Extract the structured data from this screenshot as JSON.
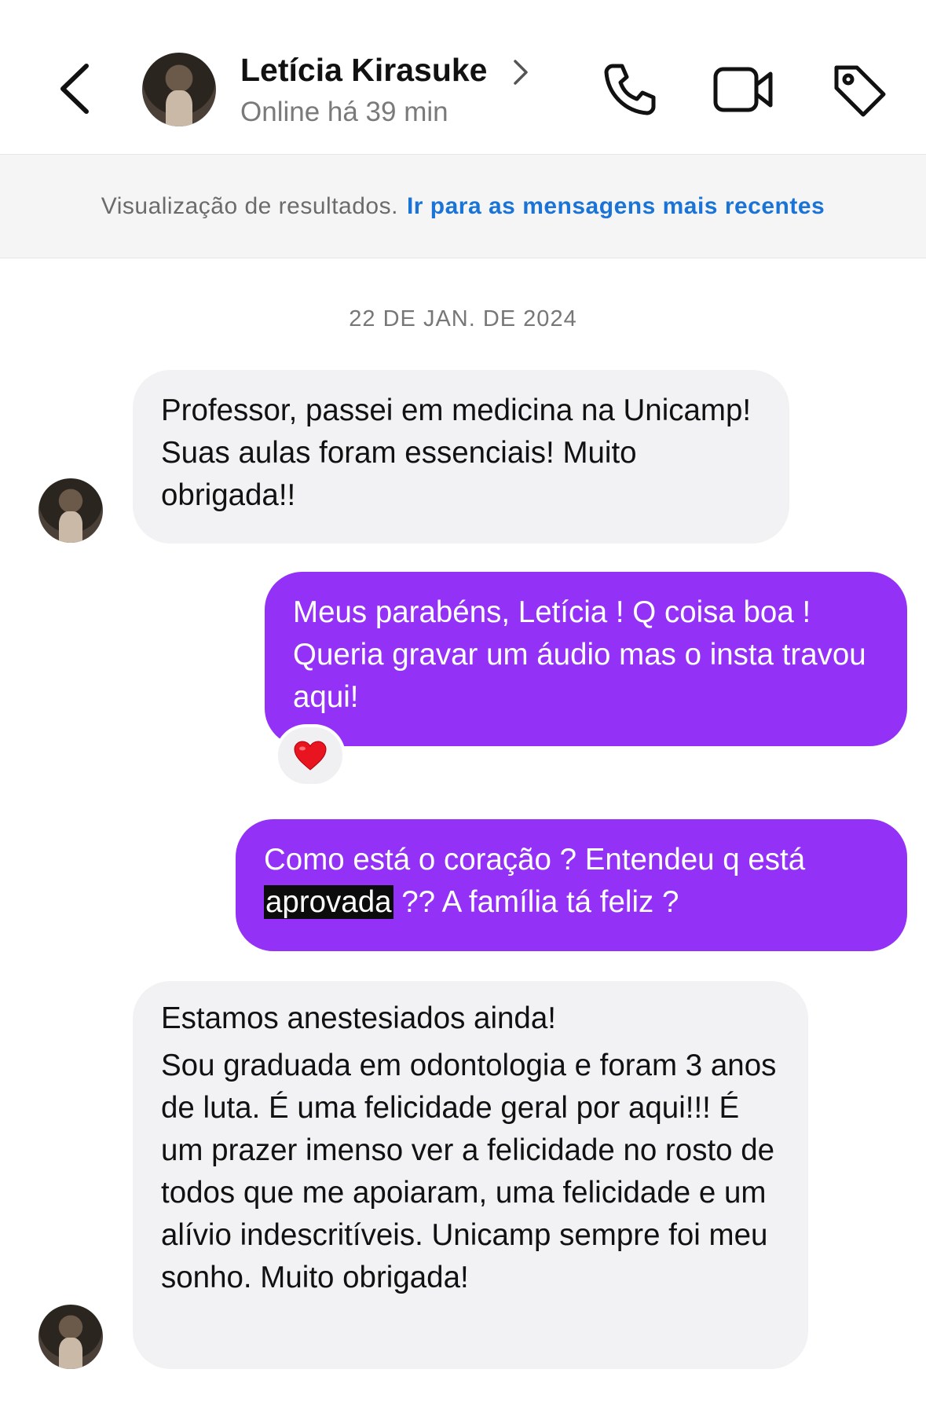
{
  "header": {
    "contact_name": "Letícia Kirasuke",
    "status": "Online há 39 min",
    "icons": [
      "back-icon",
      "chevron-right-icon",
      "phone-icon",
      "video-icon",
      "tag-icon"
    ]
  },
  "banner": {
    "text": "Visualização de resultados.",
    "link": "Ir para as mensagens mais recentes",
    "link_color": "#1a74d8"
  },
  "date_separator": "22 DE JAN. DE 2024",
  "colors": {
    "outgoing_bubble": "#9431f7",
    "incoming_bubble": "#f2f2f4",
    "highlight": "#0c0c0c"
  },
  "messages": [
    {
      "sender": "contact",
      "text": "Professor, passei em medicina na Unicamp! Suas aulas foram essenciais! Muito obrigada!!"
    },
    {
      "sender": "me",
      "text": "Meus parabéns, Letícia ! Q coisa boa ! Queria gravar um áudio mas o insta travou aqui!",
      "reaction": "❤️"
    },
    {
      "sender": "me",
      "text_before": "Como está o coração ? Entendeu q está ",
      "highlighted": "aprovada",
      "text_after": " ?? A família tá feliz ?"
    },
    {
      "sender": "contact",
      "line1": "Estamos anestesiados ainda!",
      "text": "Sou graduada em odontologia e foram 3 anos de luta. É uma felicidade geral por aqui!!! É um prazer imenso ver a felicidade no rosto de todos que me apoiaram, uma felicidade e um alívio indescritíveis. Unicamp sempre foi meu sonho. Muito obrigada!"
    }
  ]
}
